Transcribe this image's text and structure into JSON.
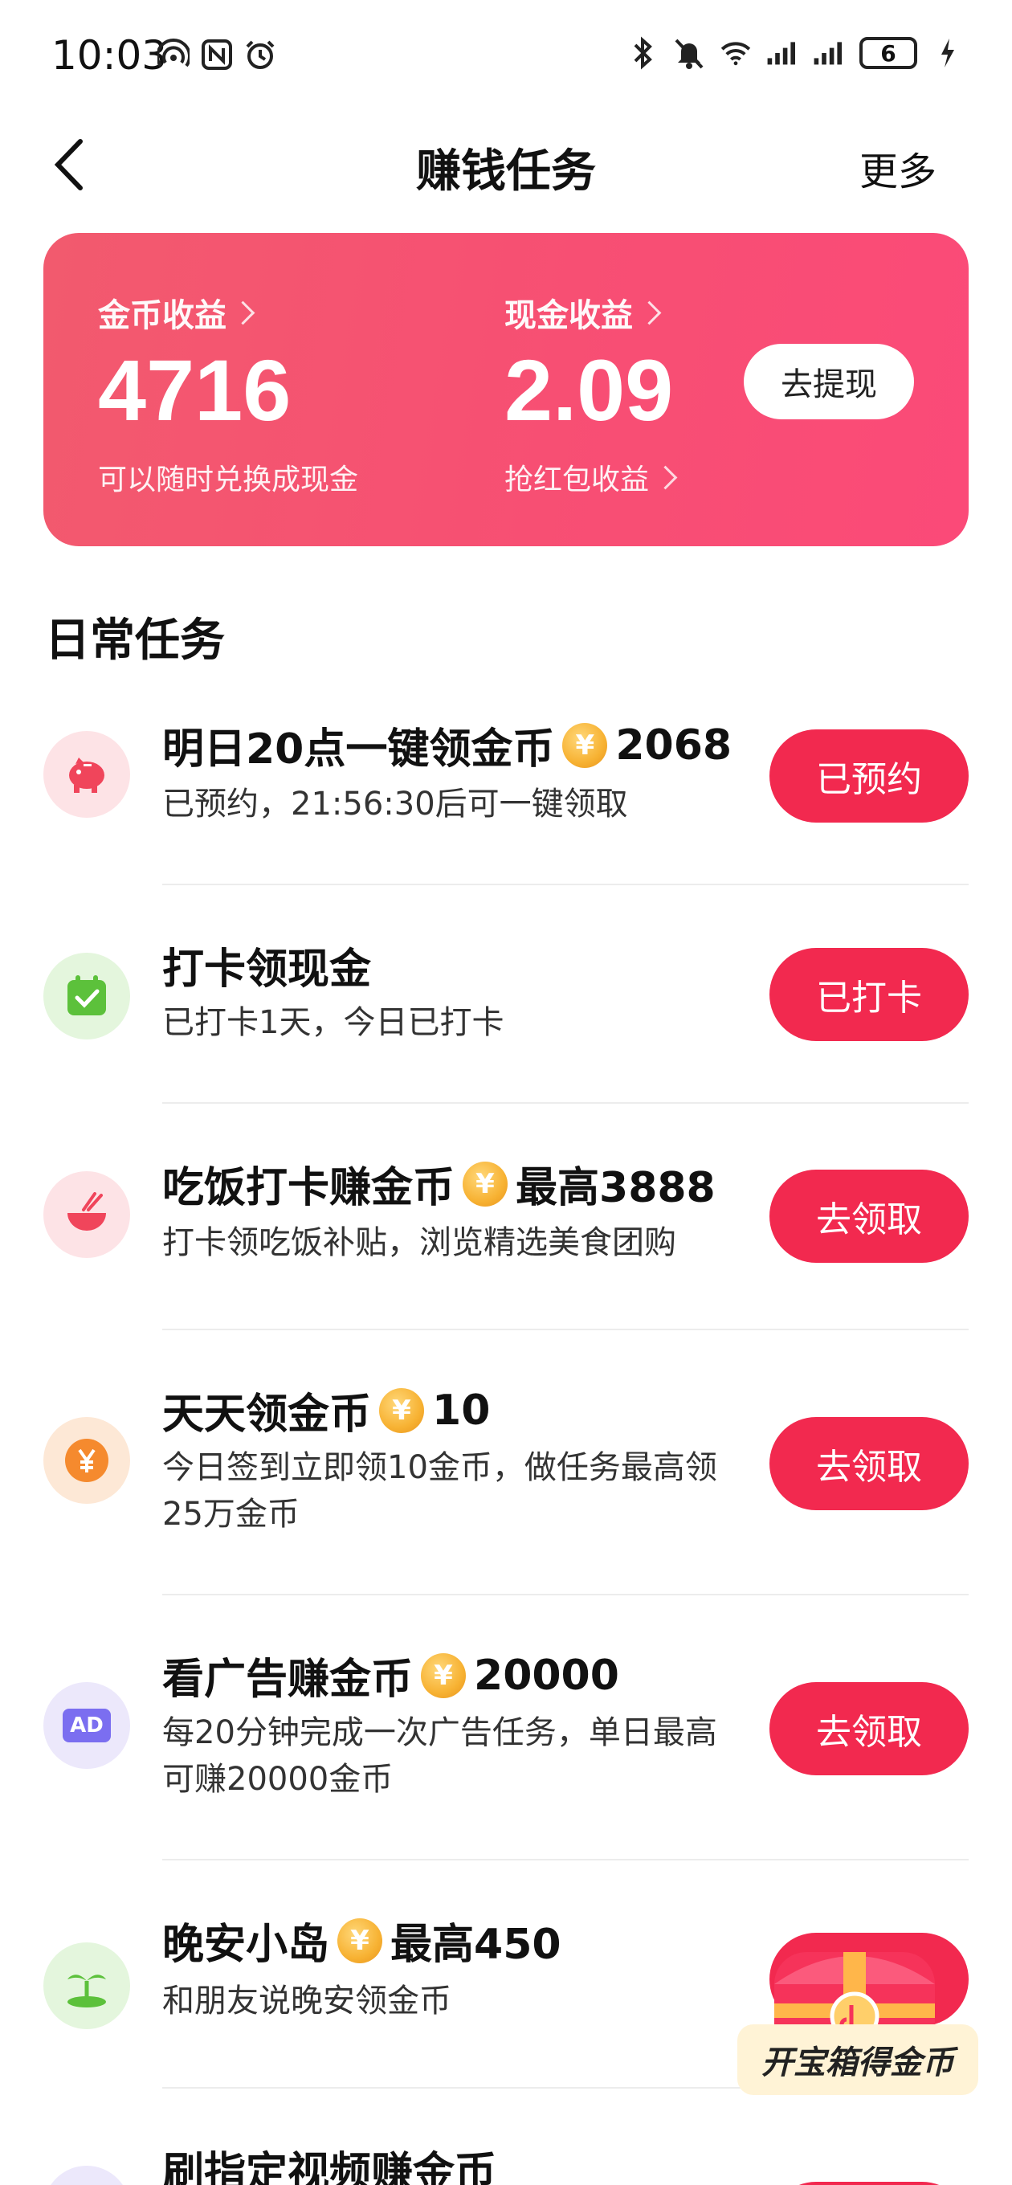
{
  "status_bar": {
    "time": "10:03",
    "battery": "6"
  },
  "nav": {
    "title": "赚钱任务",
    "more": "更多"
  },
  "earnings": {
    "coin_label": "金币收益",
    "coin_value": "4716",
    "coin_sub": "可以随时兑换成现金",
    "cash_label": "现金收益",
    "cash_value": "2.09",
    "cash_sub": "抢红包收益",
    "withdraw": "去提现"
  },
  "section_title": "日常任务",
  "tasks": [
    {
      "title": "明日20点一键领金币",
      "reward": "2068",
      "desc": "已预约，21:56:30后可一键领取",
      "button": "已预约"
    },
    {
      "title": "打卡领现金",
      "desc": "已打卡1天，今日已打卡",
      "button": "已打卡"
    },
    {
      "title": "吃饭打卡赚金币",
      "reward": "最高3888",
      "desc": "打卡领吃饭补贴，浏览精选美食团购",
      "button": "去领取"
    },
    {
      "title": "天天领金币",
      "reward": "10",
      "desc": "今日签到立即领10金币，做任务最高领25万金币",
      "button": "去领取"
    },
    {
      "title": "看广告赚金币",
      "reward": "20000",
      "desc": "每20分钟完成一次广告任务，单日最高可赚20000金币",
      "button": "去领取",
      "icon_text": "AD"
    },
    {
      "title": "晚安小岛",
      "reward": "最高450",
      "desc": "和朋友说晚安领金币"
    },
    {
      "title": "刷指定视频赚金币"
    }
  ],
  "chest_label": "开宝箱得金币",
  "coin_glyph": "¥",
  "colors": {
    "accent": "#f2294f",
    "card_start": "#f25a6e",
    "card_end": "#fb4a78"
  }
}
